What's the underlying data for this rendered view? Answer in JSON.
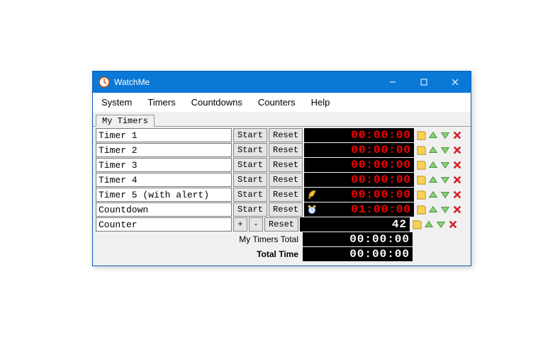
{
  "window": {
    "title": "WatchMe"
  },
  "menu": {
    "items": [
      "System",
      "Timers",
      "Countdowns",
      "Counters",
      "Help"
    ]
  },
  "tab": {
    "label": "My Timers"
  },
  "rows": [
    {
      "name": "Timer 1",
      "btn1": "Start",
      "btn2": "Reset",
      "display": "00:00:00",
      "red": true,
      "pre": null
    },
    {
      "name": "Timer 2",
      "btn1": "Start",
      "btn2": "Reset",
      "display": "00:00:00",
      "red": true,
      "pre": null
    },
    {
      "name": "Timer 3",
      "btn1": "Start",
      "btn2": "Reset",
      "display": "00:00:00",
      "red": true,
      "pre": null
    },
    {
      "name": "Timer 4",
      "btn1": "Start",
      "btn2": "Reset",
      "display": "00:00:00",
      "red": true,
      "pre": null
    },
    {
      "name": "Timer 5 (with alert)",
      "btn1": "Start",
      "btn2": "Reset",
      "display": "00:00:00",
      "red": true,
      "pre": "bell"
    },
    {
      "name": "Countdown",
      "btn1": "Start",
      "btn2": "Reset",
      "display": "01:00:00",
      "red": true,
      "pre": "clock"
    },
    {
      "name": "Counter",
      "btn1": "+",
      "btn2": "-",
      "btn3": "Reset",
      "display": "42",
      "red": false,
      "pre": null,
      "counter": true
    }
  ],
  "totals": {
    "group_label": "My Timers Total",
    "group_value": "00:00:00",
    "all_label": "Total Time",
    "all_value": "00:00:00"
  }
}
